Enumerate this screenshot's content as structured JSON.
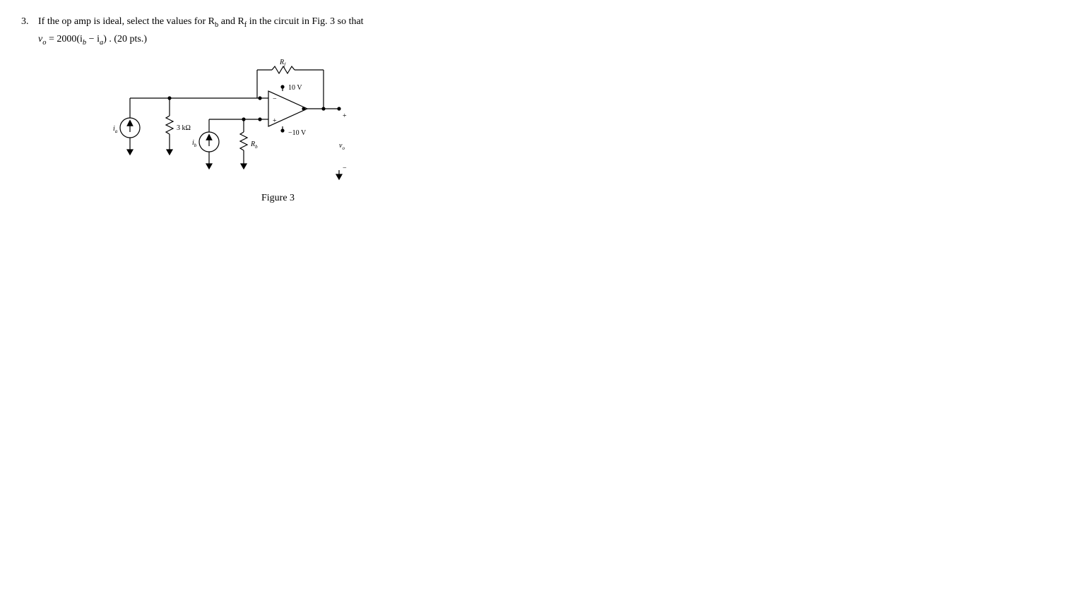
{
  "problem": {
    "number": "3.",
    "line1_a": "If  the  op  amp  is  ideal,  select  the  values  for  R",
    "line1_b": "  and  R",
    "line1_c": "  in  the  circuit  in  Fig.  3  so  that",
    "sub_b": "b",
    "sub_f": "f",
    "line2_a": "v",
    "line2_b": " = 2000(i",
    "line2_c": " − i",
    "line2_d": ") . (20 pts.)",
    "sub_o": "o",
    "sub_ib": "b",
    "sub_ia": "a"
  },
  "labels": {
    "Rf": "R",
    "Rf_sub": "f",
    "Rb": "R",
    "Rb_sub": "b",
    "r3k": "3 kΩ",
    "ia": "i",
    "ia_sub": "a",
    "ib": "i",
    "ib_sub": "b",
    "p10": "10 V",
    "n10": "−10 V",
    "vo": "v",
    "vo_sub": "o",
    "plus": "+",
    "minus": "−",
    "out_plus": "+",
    "out_minus": "−"
  },
  "figure": {
    "caption": "Figure 3"
  }
}
